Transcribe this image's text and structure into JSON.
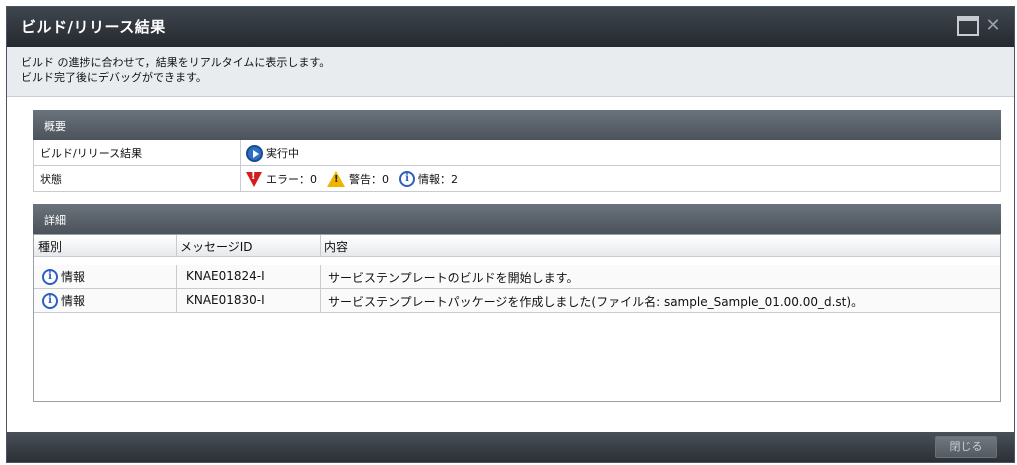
{
  "window": {
    "title": "ビルド/リリース結果"
  },
  "description": {
    "line1": "ビルド の進捗に合わせて，結果をリアルタイムに表示します。",
    "line2": "ビルド完了後にデバッグができます。"
  },
  "overview": {
    "heading": "概要",
    "result_label": "ビルド/リリース結果",
    "result_value": "実行中",
    "state_label": "状態",
    "error_text": "エラー：0",
    "warning_text": "警告：0",
    "info_text": "情報：2"
  },
  "details": {
    "heading": "詳細",
    "columns": [
      "種別",
      "メッセージID",
      "内容"
    ],
    "rows": [
      {
        "type": "情報",
        "message_id": "KNAE01824-I",
        "content": "サービステンプレートのビルドを開始します。"
      },
      {
        "type": "情報",
        "message_id": "KNAE01830-I",
        "content": "サービステンプレートパッケージを作成しました(ファイル名: sample_Sample_01.00.00_d.st)。"
      }
    ]
  },
  "footer": {
    "close_label": "閉じる"
  },
  "icons": {
    "info": "info-icon",
    "running": "play-icon",
    "error": "error-icon",
    "warning": "warning-icon",
    "maximize": "maximize-icon",
    "close": "close-icon"
  },
  "colors": {
    "titlebar": "#2f353c",
    "section_header": "#5b626a",
    "info_blue": "#2d5fbf",
    "error_red": "#d21e1e",
    "warning_yellow": "#f0b400"
  }
}
